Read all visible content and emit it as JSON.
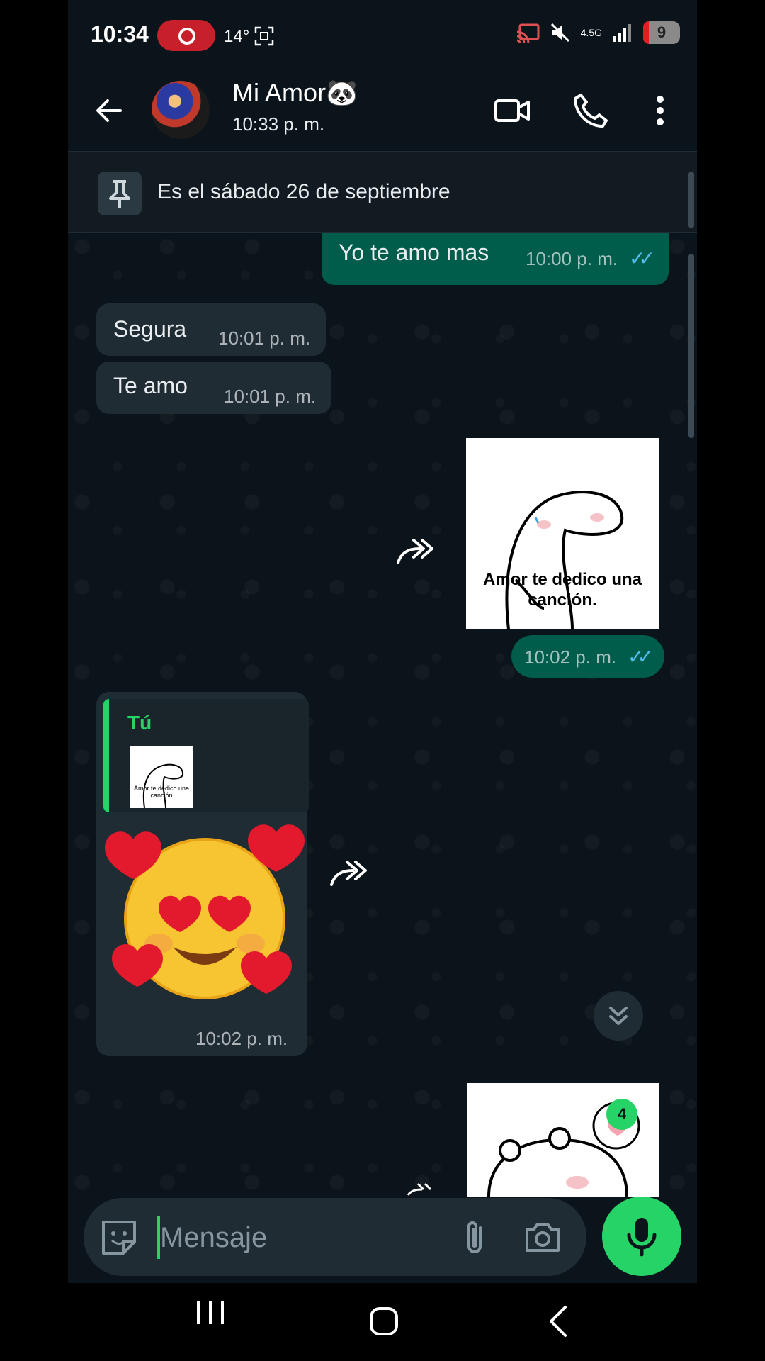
{
  "status_bar": {
    "time": "10:34",
    "temperature": "14°",
    "network": "4.5G",
    "battery": "9"
  },
  "header": {
    "contact_name": "Mi Amor🐼",
    "last_seen": "10:33 p. m."
  },
  "pinned": {
    "text": "Es el sábado 26 de septiembre"
  },
  "messages": [
    {
      "direction": "out",
      "text": "Yo te amo mas",
      "time": "10:00 p. m.",
      "status": "read"
    },
    {
      "direction": "in",
      "text": "Segura",
      "time": "10:01 p. m."
    },
    {
      "direction": "in",
      "text": "Te amo",
      "time": "10:01 p. m."
    },
    {
      "direction": "out",
      "type": "sticker",
      "sticker_text": "Amor te dedico una canción.",
      "time": "10:02 p. m.",
      "status": "read"
    },
    {
      "direction": "in",
      "type": "reply-sticker",
      "reply_author": "Tú",
      "reply_thumb_text": "Amor te dedico una canción",
      "sticker": "heart-eyes-emoji",
      "time": "10:02 p. m."
    },
    {
      "direction": "out",
      "type": "sticker",
      "sticker": "bear-sticker-partial"
    }
  ],
  "unread_count": "4",
  "composer": {
    "placeholder": "Mensaje"
  },
  "colors": {
    "accent": "#25d366",
    "outgoing_bubble": "#005c4b",
    "incoming_bubble": "#202c33",
    "read_ticks": "#53bdeb",
    "background": "#0b141a"
  }
}
